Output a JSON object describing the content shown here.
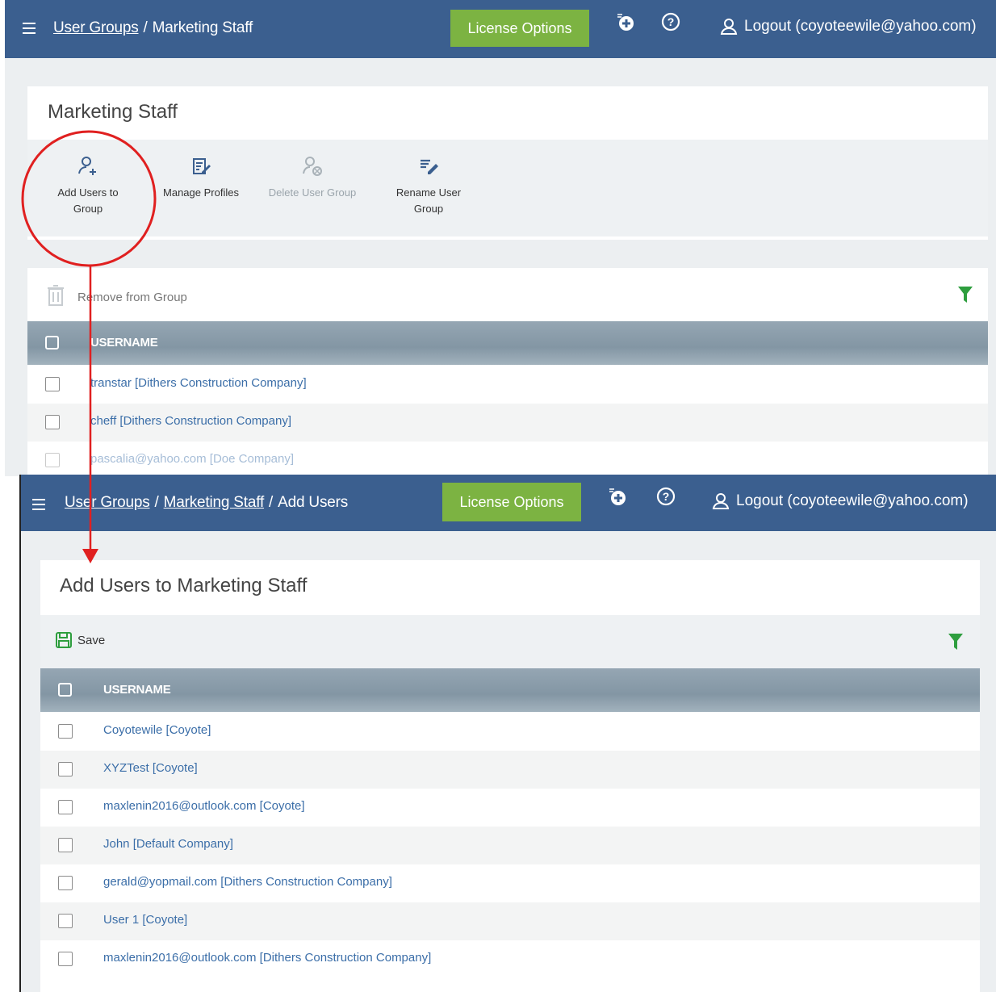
{
  "screen1": {
    "breadcrumb": [
      "User Groups",
      "Marketing Staff"
    ],
    "license_button": "License Options",
    "logout": "Logout (coyoteewile@yahoo.com)",
    "panel_title": "Marketing Staff",
    "tools": {
      "add_users": "Add Users to Group",
      "manage_profiles": "Manage Profiles",
      "delete_group": "Delete User Group",
      "rename_group": "Rename User Group"
    },
    "remove_label": "Remove from Group",
    "column_header": "USERNAME",
    "rows": [
      "transtar [Dithers Construction Company]",
      "cheff [Dithers Construction Company]",
      "pascalia@yahoo.com [Doe Company]"
    ]
  },
  "screen2": {
    "breadcrumb": [
      "User Groups",
      "Marketing Staff",
      "Add Users"
    ],
    "license_button": "License Options",
    "logout": "Logout (coyoteewile@yahoo.com)",
    "panel_title": "Add Users to Marketing Staff",
    "save_label": "Save",
    "column_header": "USERNAME",
    "rows": [
      "Coyotewile [Coyote]",
      "XYZTest [Coyote]",
      "maxlenin2016@outlook.com [Coyote]",
      "John [Default Company]",
      "gerald@yopmail.com [Dithers Construction Company]",
      "User 1 [Coyote]",
      "maxlenin2016@outlook.com [Dithers Construction Company]"
    ]
  },
  "colors": {
    "topbar": "#3b5f8f",
    "license_button": "#7cb342",
    "grid_header": "#8a9caa",
    "link": "#3b6ea8",
    "annotation": "#e02020",
    "filter": "#2e9e3e"
  },
  "icons": [
    "hamburger-icon",
    "add-circle-icon",
    "help-icon",
    "user-icon",
    "add-user-icon",
    "edit-list-icon",
    "delete-user-icon",
    "rename-icon",
    "trash-icon",
    "filter-icon",
    "save-icon"
  ]
}
